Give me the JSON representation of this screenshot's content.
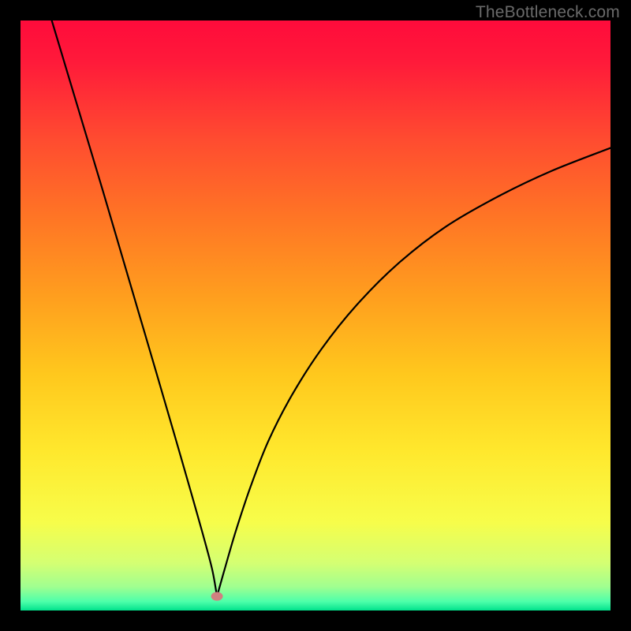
{
  "watermark": "TheBottleneck.com",
  "chart_data": {
    "type": "line",
    "title": "",
    "xlabel": "",
    "ylabel": "",
    "xlim": [
      0,
      100
    ],
    "ylim": [
      0,
      100
    ],
    "grid": false,
    "legend": false,
    "annotations": [],
    "background_gradient": {
      "stops": [
        {
          "offset": 0.0,
          "color": "#ff0b3b"
        },
        {
          "offset": 0.07,
          "color": "#ff1a3a"
        },
        {
          "offset": 0.2,
          "color": "#ff4b30"
        },
        {
          "offset": 0.33,
          "color": "#ff7425"
        },
        {
          "offset": 0.47,
          "color": "#ff9f1e"
        },
        {
          "offset": 0.6,
          "color": "#ffc81d"
        },
        {
          "offset": 0.73,
          "color": "#ffe82d"
        },
        {
          "offset": 0.85,
          "color": "#f7fd4a"
        },
        {
          "offset": 0.92,
          "color": "#d4ff73"
        },
        {
          "offset": 0.96,
          "color": "#a0ff90"
        },
        {
          "offset": 0.985,
          "color": "#4dffaa"
        },
        {
          "offset": 1.0,
          "color": "#00e28c"
        }
      ]
    },
    "dot": {
      "cx": 33.3,
      "cy": 2.4,
      "rx": 1.0,
      "ry": 0.75,
      "fill": "#d08080"
    },
    "series": [
      {
        "name": "left-branch",
        "x": [
          5.3,
          8.0,
          11.0,
          14.0,
          17.0,
          20.0,
          23.0,
          26.0,
          29.0,
          31.0,
          32.5,
          33.3
        ],
        "y": [
          100.0,
          91.0,
          81.0,
          71.0,
          60.8,
          50.6,
          40.4,
          30.1,
          19.7,
          12.6,
          6.9,
          2.4
        ]
      },
      {
        "name": "right-branch",
        "x": [
          33.3,
          34.6,
          36.5,
          39.0,
          42.0,
          46.0,
          51.0,
          57.0,
          64.0,
          72.0,
          81.0,
          90.0,
          100.0
        ],
        "y": [
          2.4,
          7.0,
          13.5,
          21.0,
          28.7,
          36.5,
          44.3,
          51.8,
          58.8,
          65.0,
          70.2,
          74.5,
          78.4
        ]
      }
    ],
    "line_style": {
      "stroke": "#000000",
      "stroke_width_px": 2.2
    },
    "frame_border_px": 26
  }
}
